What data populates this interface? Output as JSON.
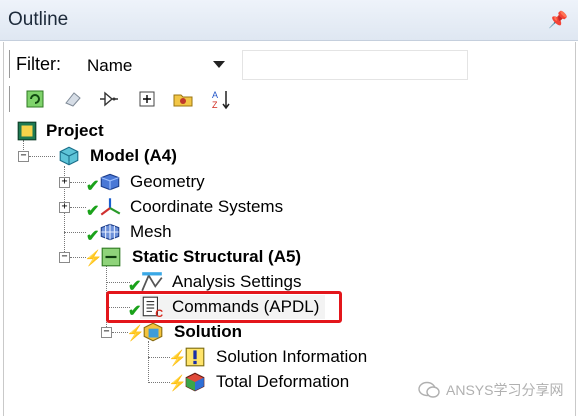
{
  "panel": {
    "title": "Outline",
    "pin_icon": "pin-icon"
  },
  "filter": {
    "label": "Filter:",
    "value": "Name",
    "text_value": ""
  },
  "toolbar": {
    "buttons": [
      "refresh-icon",
      "eraser-icon",
      "gate-icon",
      "expand-all-icon",
      "folder-icon",
      "sort-az-icon"
    ]
  },
  "tree": {
    "project": "Project",
    "model": "Model (A4)",
    "geometry": "Geometry",
    "coordinate_systems": "Coordinate Systems",
    "mesh": "Mesh",
    "static_structural": "Static Structural (A5)",
    "analysis_settings": "Analysis Settings",
    "commands": "Commands (APDL)",
    "solution": "Solution",
    "solution_information": "Solution Information",
    "total_deformation": "Total Deformation"
  },
  "watermark": {
    "text": "ANSYS学习分享网"
  },
  "colors": {
    "highlight": "#e3161b",
    "check": "#1aa21a",
    "bolt": "#e8b400"
  }
}
